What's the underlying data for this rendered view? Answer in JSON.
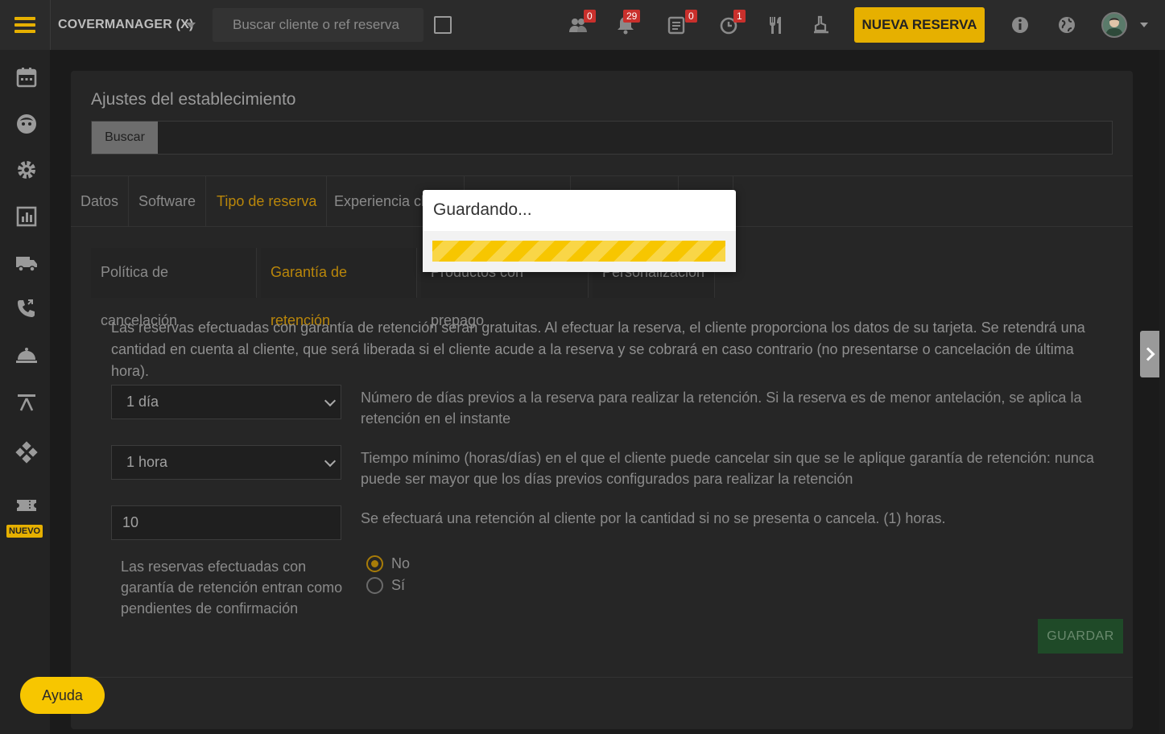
{
  "topbar": {
    "venue": "COVERMANAGER (X)",
    "search_placeholder": "Buscar cliente o ref reserva",
    "badges": {
      "people": "0",
      "bell": "29",
      "list": "0",
      "clock": "1"
    },
    "new_reservation": "NUEVA RESERVA",
    "accent_color": "#e6b000"
  },
  "sidebar": {
    "icons": [
      "calendar-icon",
      "face-icon",
      "gear-icon",
      "chart-icon",
      "truck-icon",
      "phone-icon",
      "cloche-icon",
      "gate-icon",
      "gamepad-icon",
      "ticket-icon"
    ],
    "nuevo_badge": "NUEVO"
  },
  "panel": {
    "title": "Ajustes del establecimiento",
    "search_button": "Buscar",
    "tabs": [
      "Datos",
      "Software",
      "Tipo de reserva",
      "Experiencia cl"
    ],
    "active_tab": "Tipo de reserva",
    "subtabs": [
      "Política de cancelación",
      "Garantía de retención",
      "Productos con prepago",
      "Personalización"
    ],
    "active_subtab": "Garantía de retención",
    "description": "Las reservas efectuadas con garantía de retención serán gratuitas. Al efectuar la reserva, el cliente proporciona los datos de su tarjeta. Se retendrá una cantidad en cuenta al cliente, que será liberada si el cliente acude a la reserva y se cobrará en caso contrario (no presentarse o cancelación de última hora).",
    "days_select": "1 día",
    "days_help": "Número de días previos a la reserva para realizar la retención. Si la reserva es de menor antelación, se aplica la retención en el instante",
    "hours_select": "1 hora",
    "hours_help": "Tiempo mínimo (horas/días) en el que el cliente puede cancelar sin que se le aplique garantía de retención: nunca puede ser mayor que los días previos configurados para realizar la retención",
    "amount_value": "10",
    "amount_help": "Se efectuará una retención al cliente por la cantidad si no se presenta o cancela. (1) horas.",
    "pending_label": "Las reservas efectuadas con garantía de retención entran como pendientes de confirmación",
    "radio_no": "No",
    "radio_si": "Sí",
    "radio_selected": "No",
    "save_button": "GUARDAR"
  },
  "help_button": "Ayuda",
  "modal": {
    "title": "Guardando...",
    "progress_color": "#f7c600"
  }
}
